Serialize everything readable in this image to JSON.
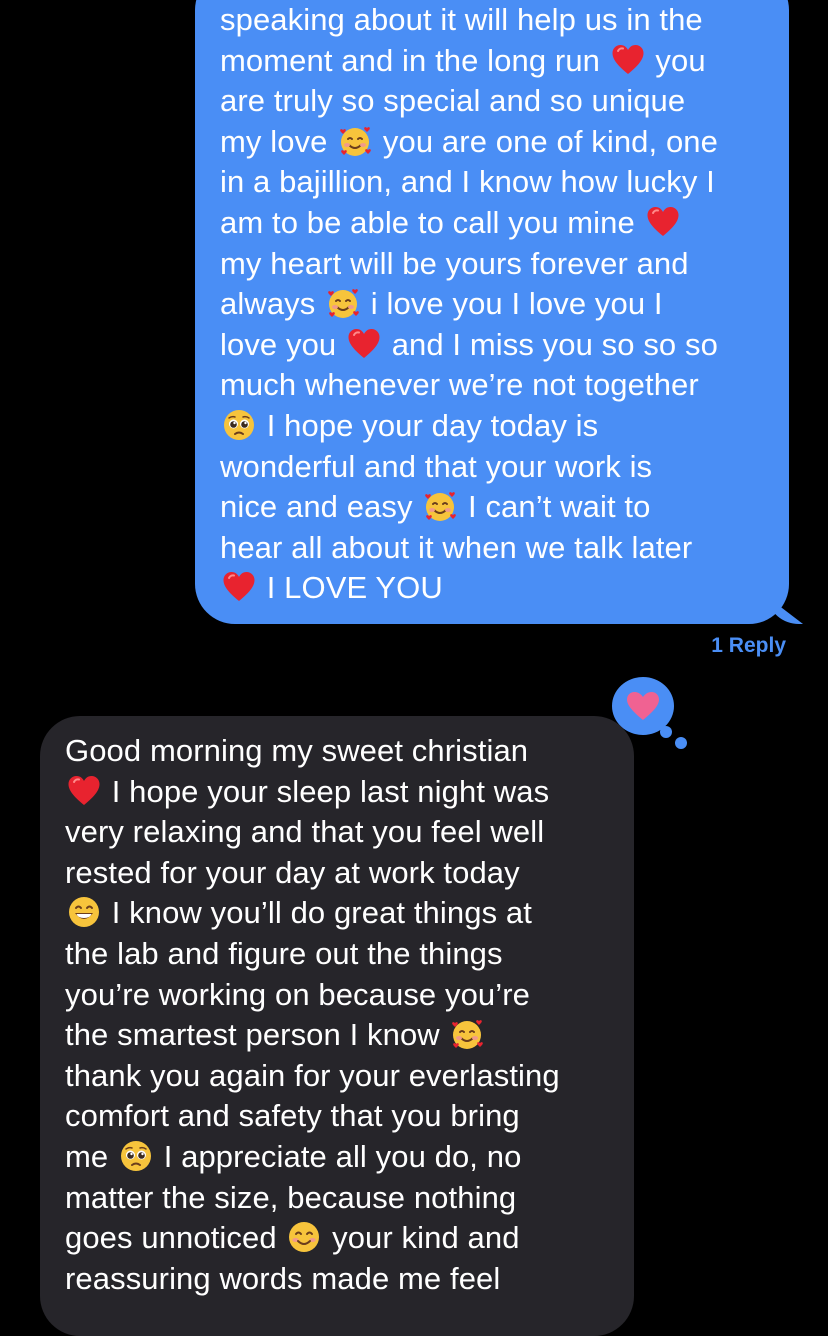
{
  "conversation": {
    "sent_message": {
      "lines": [
        [
          "speaking about it will help us in the"
        ],
        [
          "moment and in the long run ",
          "heart-icon",
          " you"
        ],
        [
          "are truly so special and so unique"
        ],
        [
          "my love ",
          "smiling-face-with-hearts-icon",
          " you are one of kind, one"
        ],
        [
          "in a bajillion, and I know how lucky I"
        ],
        [
          "am to be able to call you mine ",
          "heart-icon"
        ],
        [
          "my heart will be yours forever and"
        ],
        [
          "always ",
          "smiling-face-with-hearts-icon",
          " i love you I love you I"
        ],
        [
          "love you ",
          "heart-icon",
          " and I miss you so so so"
        ],
        [
          "much whenever we’re not together"
        ],
        [
          "pleading-face-icon",
          " I hope your day today is"
        ],
        [
          "wonderful and that your work is"
        ],
        [
          "nice and easy ",
          "smiling-face-with-hearts-icon",
          " I can’t wait to"
        ],
        [
          "hear all about it when we talk later"
        ],
        [
          "heart-icon",
          " I LOVE YOU"
        ]
      ],
      "reply_count_label": "1 Reply"
    },
    "tapback": {
      "icon": "heart-icon",
      "color": "#f06292"
    },
    "received_message": {
      "lines": [
        [
          "Good morning my sweet christian"
        ],
        [
          "heart-icon",
          " I hope your sleep last night was"
        ],
        [
          "very relaxing and that you feel well"
        ],
        [
          "rested for your day at work today"
        ],
        [
          "grinning-face-icon",
          " I know you’ll do great things at"
        ],
        [
          "the lab and figure out the things"
        ],
        [
          "you’re working on because you’re"
        ],
        [
          "the smartest person I know ",
          "smiling-face-with-hearts-icon"
        ],
        [
          "thank you again for your everlasting"
        ],
        [
          "comfort and safety that you bring"
        ],
        [
          "me ",
          "pleading-face-icon",
          " I appreciate all you do, no"
        ],
        [
          "matter the size, because nothing"
        ],
        [
          "goes unnoticed ",
          "smiling-face-icon",
          " your kind and"
        ],
        [
          "reassuring words made me feel"
        ]
      ]
    }
  },
  "colors": {
    "sent_bubble": "#4a8ef5",
    "received_bubble": "#26252a",
    "background": "#000000",
    "text": "#ffffff"
  }
}
